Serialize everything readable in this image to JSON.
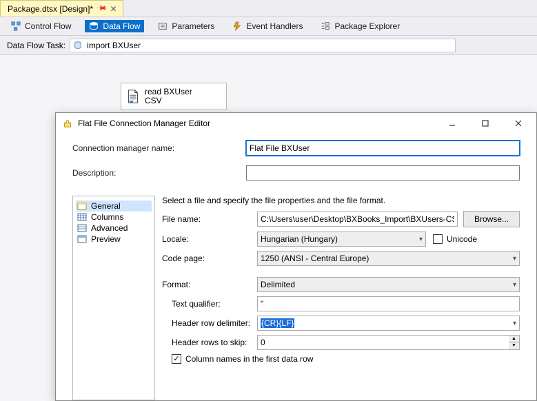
{
  "doc_tab": {
    "title": "Package.dtsx [Design]*"
  },
  "toolbar": {
    "control_flow": "Control Flow",
    "data_flow": "Data Flow",
    "parameters": "Parameters",
    "event_handlers": "Event Handlers",
    "package_explorer": "Package Explorer"
  },
  "task_row": {
    "label": "Data Flow Task:",
    "value": "import BXUser"
  },
  "canvas_node": {
    "line1": "read BXUser",
    "line2": "CSV"
  },
  "dialog": {
    "title": "Flat File Connection Manager Editor",
    "conn_name_label": "Connection manager name:",
    "conn_name_value": "Flat File BXUser",
    "desc_label": "Description:",
    "desc_value": "",
    "tree": {
      "items": [
        "General",
        "Columns",
        "Advanced",
        "Preview"
      ],
      "selected": 0
    },
    "form": {
      "header": "Select a file and specify the file properties and the file format.",
      "file_name_label": "File name:",
      "file_name_value": "C:\\Users\\user\\Desktop\\BXBooks_Import\\BXUsers-CSV",
      "browse_label": "Browse...",
      "locale_label": "Locale:",
      "locale_value": "Hungarian (Hungary)",
      "unicode_label": "Unicode",
      "unicode_checked": false,
      "codepage_label": "Code page:",
      "codepage_value": "1250  (ANSI - Central Europe)",
      "format_label": "Format:",
      "format_value": "Delimited",
      "textq_label": "Text qualifier:",
      "textq_value": "\"",
      "hdr_delim_label": "Header row delimiter:",
      "hdr_delim_value": "{CR}{LF}",
      "hdr_skip_label": "Header rows to skip:",
      "hdr_skip_value": "0",
      "colnames_label": "Column names in the first data row",
      "colnames_checked": true
    }
  }
}
